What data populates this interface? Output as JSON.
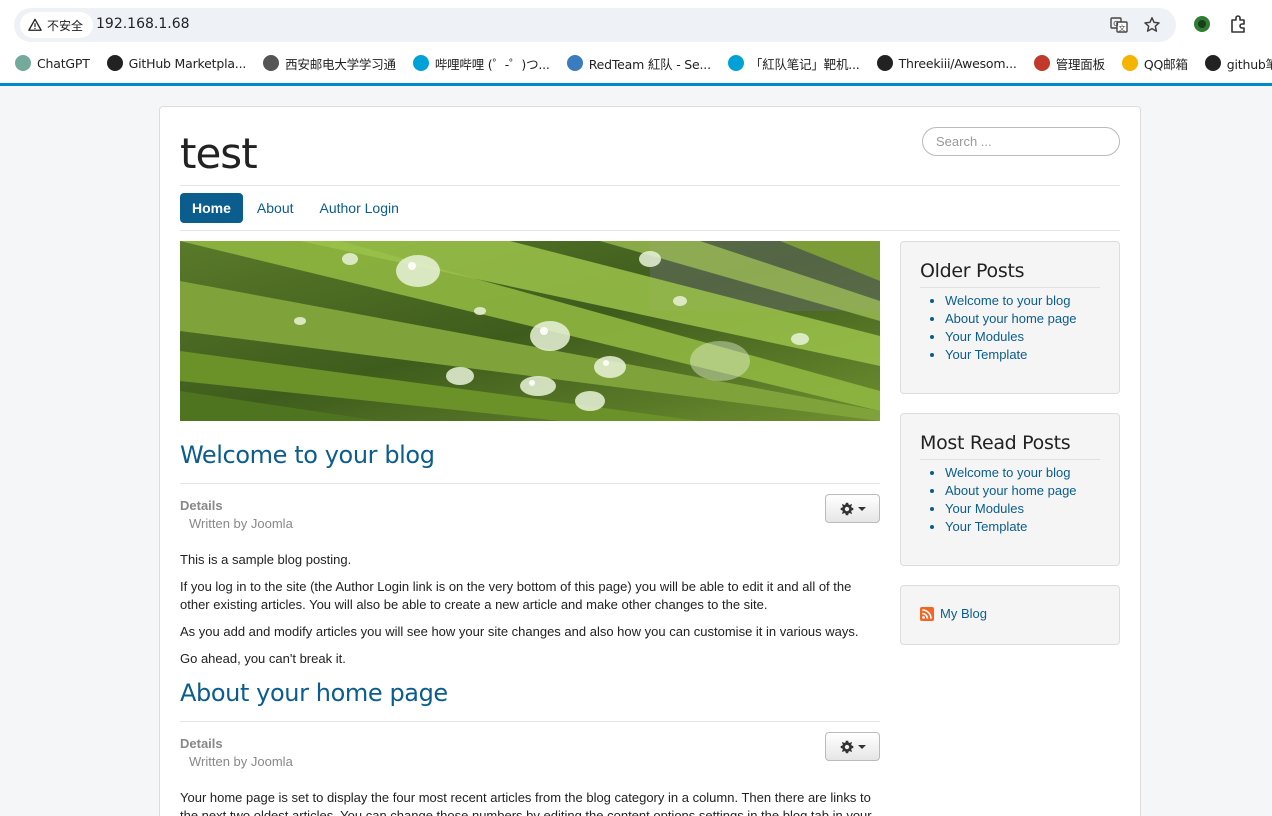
{
  "browser": {
    "security_label": "不安全",
    "url": "192.168.1.68",
    "bookmarks": [
      {
        "label": "ChatGPT",
        "color": "#74aa9c"
      },
      {
        "label": "GitHub Marketpla...",
        "color": "#222222"
      },
      {
        "label": "西安邮电大学学习通",
        "color": "#555555"
      },
      {
        "label": "哔哩哔哩 (゜-゜)つ...",
        "color": "#00a1d6"
      },
      {
        "label": "RedTeam 紅队 - Se...",
        "color": "#3b7bbf"
      },
      {
        "label": "「紅队笔记」靶机...",
        "color": "#00a1d6"
      },
      {
        "label": "Threekiii/Awesom...",
        "color": "#222222"
      },
      {
        "label": "管理面板",
        "color": "#c0392b"
      },
      {
        "label": "QQ邮箱",
        "color": "#f4b400"
      },
      {
        "label": "github笔记",
        "color": "#222222"
      }
    ]
  },
  "site": {
    "title": "test",
    "search_placeholder": "Search ..."
  },
  "nav": [
    {
      "label": "Home",
      "active": true
    },
    {
      "label": "About",
      "active": false
    },
    {
      "label": "Author Login",
      "active": false
    }
  ],
  "articles": [
    {
      "title": "Welcome to your blog",
      "details": "Details",
      "written_by": "Written by Joomla",
      "paragraphs": [
        "This is a sample blog posting.",
        "If you log in to the site (the Author Login link is on the very bottom of this page) you will be able to edit it and all of the other existing articles. You will also be able to create a new article and make other changes to the site.",
        "As you add and modify articles you will see how your site changes and also how you can customise it in various ways.",
        "Go ahead, you can't break it."
      ]
    },
    {
      "title": "About your home page",
      "details": "Details",
      "written_by": "Written by Joomla",
      "paragraphs": [
        "Your home page is set to display the four most recent articles from the blog category in a column. Then there are links to the next two oldest articles. You can change those numbers by editing the content options settings in the blog tab in your"
      ]
    }
  ],
  "sidebar": {
    "older_posts": {
      "title": "Older Posts",
      "items": [
        "Welcome to your blog",
        "About your home page",
        "Your Modules",
        "Your Template"
      ]
    },
    "most_read": {
      "title": "Most Read Posts",
      "items": [
        "Welcome to your blog",
        "About your home page",
        "Your Modules",
        "Your Template"
      ]
    },
    "feed": {
      "label": "My Blog"
    }
  },
  "colors": {
    "accent": "#0b5d8e",
    "browser_line": "#0088cc"
  }
}
